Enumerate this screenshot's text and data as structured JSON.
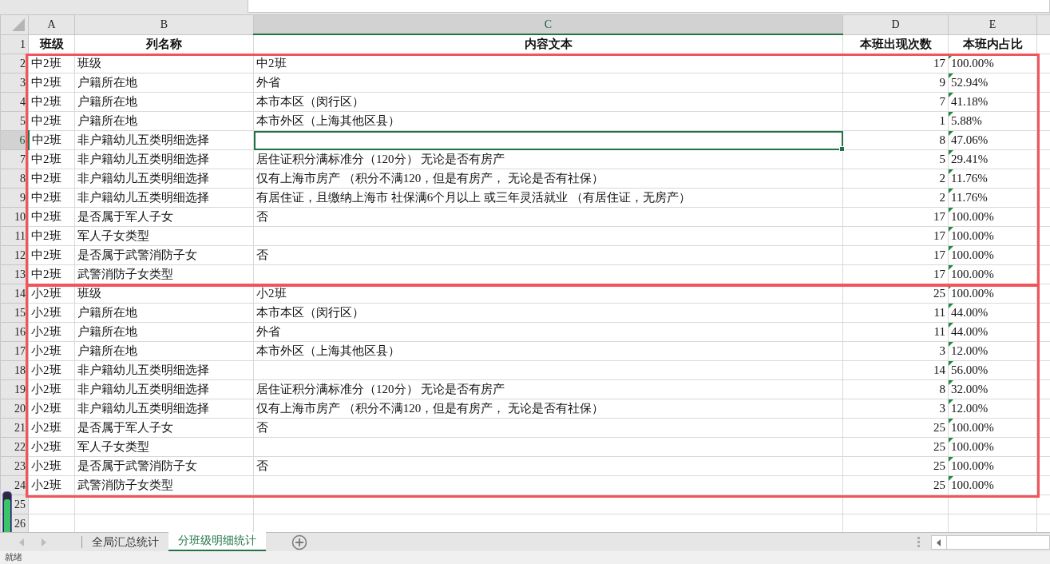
{
  "columns": [
    {
      "letter": "A",
      "selected": false
    },
    {
      "letter": "B",
      "selected": false
    },
    {
      "letter": "C",
      "selected": true
    },
    {
      "letter": "D",
      "selected": false
    },
    {
      "letter": "E",
      "selected": false
    }
  ],
  "header_row": {
    "number": "1",
    "cells": {
      "a": "班级",
      "b": "列名称",
      "c": "内容文本",
      "d": "本班出现次数",
      "e": "本班内占比"
    }
  },
  "groups": [
    {
      "highlighted": true,
      "rows": [
        {
          "number": "2",
          "selected": false,
          "flagged": true,
          "cells": {
            "a": "中2班",
            "b": "班级",
            "c": "中2班",
            "d": "17",
            "e": "100.00%"
          }
        },
        {
          "number": "3",
          "selected": false,
          "flagged": true,
          "cells": {
            "a": "中2班",
            "b": "户籍所在地",
            "c": "外省",
            "d": "9",
            "e": "52.94%"
          }
        },
        {
          "number": "4",
          "selected": false,
          "flagged": true,
          "cells": {
            "a": "中2班",
            "b": "户籍所在地",
            "c": "本市本区（闵行区）",
            "d": "7",
            "e": "41.18%"
          }
        },
        {
          "number": "5",
          "selected": false,
          "flagged": true,
          "cells": {
            "a": "中2班",
            "b": "户籍所在地",
            "c": "本市外区（上海其他区县）",
            "d": "1",
            "e": "5.88%"
          }
        },
        {
          "number": "6",
          "selected": true,
          "flagged": true,
          "cells": {
            "a": "中2班",
            "b": "非户籍幼儿五类明细选择",
            "d": "8",
            "e": "47.06%"
          }
        },
        {
          "number": "7",
          "selected": false,
          "flagged": true,
          "cells": {
            "a": "中2班",
            "b": "非户籍幼儿五类明细选择",
            "c": "居住证积分满标准分（120分） 无论是否有房产",
            "d": "5",
            "e": "29.41%"
          }
        },
        {
          "number": "8",
          "selected": false,
          "flagged": true,
          "cells": {
            "a": "中2班",
            "b": "非户籍幼儿五类明细选择",
            "c": "仅有上海市房产 （积分不满120，但是有房产， 无论是否有社保）",
            "d": "2",
            "e": "11.76%"
          }
        },
        {
          "number": "9",
          "selected": false,
          "flagged": true,
          "cells": {
            "a": "中2班",
            "b": "非户籍幼儿五类明细选择",
            "c": "有居住证，且缴纳上海市 社保满6个月以上 或三年灵活就业 （有居住证，无房产）",
            "d": "2",
            "e": "11.76%"
          }
        },
        {
          "number": "10",
          "selected": false,
          "flagged": true,
          "cells": {
            "a": "中2班",
            "b": "是否属于军人子女",
            "c": "否",
            "d": "17",
            "e": "100.00%"
          }
        },
        {
          "number": "11",
          "selected": false,
          "flagged": true,
          "cells": {
            "a": "中2班",
            "b": "军人子女类型",
            "d": "17",
            "e": "100.00%"
          }
        },
        {
          "number": "12",
          "selected": false,
          "flagged": true,
          "cells": {
            "a": "中2班",
            "b": "是否属于武警消防子女",
            "c": "否",
            "d": "17",
            "e": "100.00%"
          }
        },
        {
          "number": "13",
          "selected": false,
          "flagged": true,
          "cells": {
            "a": "中2班",
            "b": "武警消防子女类型",
            "d": "17",
            "e": "100.00%"
          }
        }
      ]
    },
    {
      "highlighted": true,
      "rows": [
        {
          "number": "14",
          "selected": false,
          "flagged": true,
          "cells": {
            "a": "小2班",
            "b": "班级",
            "c": "小2班",
            "d": "25",
            "e": "100.00%"
          }
        },
        {
          "number": "15",
          "selected": false,
          "flagged": true,
          "cells": {
            "a": "小2班",
            "b": "户籍所在地",
            "c": "本市本区（闵行区）",
            "d": "11",
            "e": "44.00%"
          }
        },
        {
          "number": "16",
          "selected": false,
          "flagged": true,
          "cells": {
            "a": "小2班",
            "b": "户籍所在地",
            "c": "外省",
            "d": "11",
            "e": "44.00%"
          }
        },
        {
          "number": "17",
          "selected": false,
          "flagged": true,
          "cells": {
            "a": "小2班",
            "b": "户籍所在地",
            "c": "本市外区（上海其他区县）",
            "d": "3",
            "e": "12.00%"
          }
        },
        {
          "number": "18",
          "selected": false,
          "flagged": true,
          "cells": {
            "a": "小2班",
            "b": "非户籍幼儿五类明细选择",
            "d": "14",
            "e": "56.00%"
          }
        },
        {
          "number": "19",
          "selected": false,
          "flagged": true,
          "cells": {
            "a": "小2班",
            "b": "非户籍幼儿五类明细选择",
            "c": "居住证积分满标准分（120分） 无论是否有房产",
            "d": "8",
            "e": "32.00%"
          }
        },
        {
          "number": "20",
          "selected": false,
          "flagged": true,
          "cells": {
            "a": "小2班",
            "b": "非户籍幼儿五类明细选择",
            "c": "仅有上海市房产 （积分不满120，但是有房产， 无论是否有社保）",
            "d": "3",
            "e": "12.00%"
          }
        },
        {
          "number": "21",
          "selected": false,
          "flagged": true,
          "cells": {
            "a": "小2班",
            "b": "是否属于军人子女",
            "c": "否",
            "d": "25",
            "e": "100.00%"
          }
        },
        {
          "number": "22",
          "selected": false,
          "flagged": true,
          "cells": {
            "a": "小2班",
            "b": "军人子女类型",
            "d": "25",
            "e": "100.00%"
          }
        },
        {
          "number": "23",
          "selected": false,
          "flagged": true,
          "cells": {
            "a": "小2班",
            "b": "是否属于武警消防子女",
            "c": "否",
            "d": "25",
            "e": "100.00%"
          }
        },
        {
          "number": "24",
          "selected": false,
          "flagged": true,
          "cells": {
            "a": "小2班",
            "b": "武警消防子女类型",
            "d": "25",
            "e": "100.00%"
          }
        }
      ]
    }
  ],
  "empty_rows": [
    "25",
    "26"
  ],
  "sheet_tabs": [
    {
      "label": "全局汇总统计",
      "selected": false
    },
    {
      "label": "分班级明细统计",
      "selected": true
    }
  ],
  "status_bar": {
    "text": "就绪"
  }
}
